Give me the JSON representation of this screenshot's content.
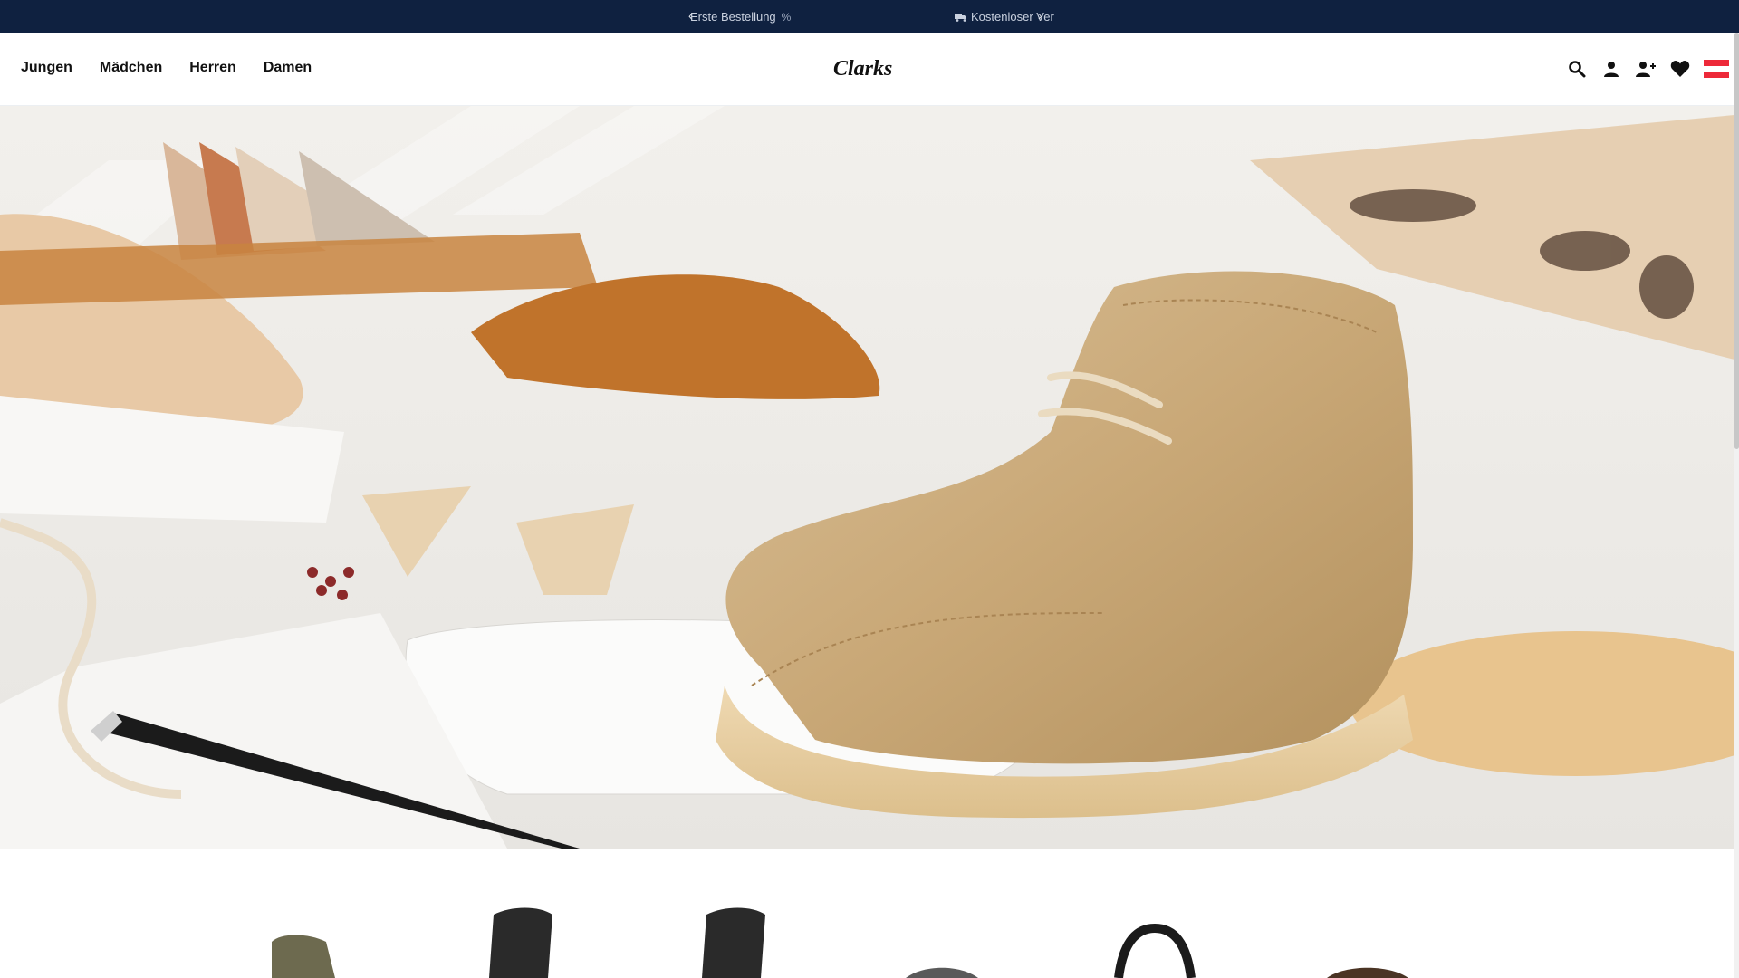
{
  "announcement": {
    "message_1": "Erste Bestellung",
    "message_2": "Kostenloser Ver",
    "prev_arrow": "‹",
    "next_arrow": "›",
    "background": "#0f2140"
  },
  "nav": {
    "items": [
      {
        "label": "Jungen"
      },
      {
        "label": "Mädchen"
      },
      {
        "label": "Herren"
      },
      {
        "label": "Damen"
      }
    ]
  },
  "brand": {
    "logo_text": "Clarks"
  },
  "header_icons": [
    "search-icon",
    "account-icon",
    "register-icon",
    "wishlist-icon",
    "austria-flag-icon"
  ],
  "flag_colors": [
    "#ed2939",
    "#ffffff",
    "#ed2939"
  ],
  "hero": {
    "subject": "beige suede desert boot"
  },
  "products": [
    "olive-boot",
    "black-tall-boot",
    "black-tall-boot",
    "patterned-sneaker",
    "black-strap-sandal",
    "brown-loafer"
  ]
}
